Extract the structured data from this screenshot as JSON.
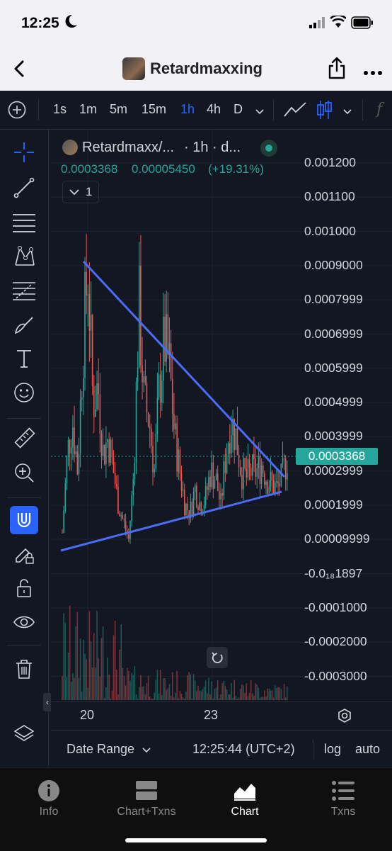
{
  "status": {
    "time": "12:25"
  },
  "nav": {
    "title": "Retardmaxxing"
  },
  "toolbar": {
    "timeframes": [
      "1s",
      "1m",
      "5m",
      "15m",
      "1h",
      "4h",
      "D"
    ],
    "active_timeframe": "1h"
  },
  "legend": {
    "symbol": "Retardmaxx/...",
    "interval": "· 1h · d...",
    "price": "0.0003368",
    "change": "0.00005450",
    "change_pct": "(+19.31%)",
    "indicator_count": "1"
  },
  "colors": {
    "up": "#26a69a",
    "down": "#ef5350",
    "trendline": "#4a6cf7",
    "accent": "#2962ff",
    "price_tag": "#26a69a"
  },
  "chart_data": {
    "type": "candlestick",
    "price_axis_labels": [
      "0.001200",
      "0.001100",
      "0.001000",
      "0.0009000",
      "0.0007999",
      "0.0006999",
      "0.0005999",
      "0.0004999",
      "0.0003999",
      "0.0002999",
      "0.0001999",
      "0.00009999",
      "-0.0₁₈1897",
      "-0.0001000",
      "-0.0002000",
      "-0.0003000"
    ],
    "current_price_label": "0.0003368",
    "time_axis_labels": [
      "20",
      "23"
    ],
    "series": [
      {
        "values": [
          0.00012,
          0.00035,
          0.00045,
          0.0003,
          0.00065,
          0.0009,
          0.0005,
          0.00055,
          0.00035,
          0.0004,
          0.0003,
          0.0002,
          0.00015,
          0.0001,
          0.0003,
          0.00079,
          0.0005,
          0.00045,
          0.0003,
          0.00055,
          0.00068,
          0.0006,
          0.0004,
          0.0003,
          0.0002,
          0.00018,
          0.00025,
          0.0002,
          0.00022,
          0.0003,
          0.00028,
          0.0002,
          0.00035,
          0.00045,
          0.0004,
          0.0003,
          0.00028,
          0.0003,
          0.0003,
          0.00032,
          0.00028,
          0.00026,
          0.00025,
          0.00028,
          0.00034
        ]
      }
    ]
  },
  "bottom": {
    "date_range": "Date Range",
    "clock": "12:25:44 (UTC+2)",
    "log": "log",
    "auto": "auto"
  },
  "tabs": [
    {
      "label": "Info"
    },
    {
      "label": "Chart+Txns"
    },
    {
      "label": "Chart"
    },
    {
      "label": "Txns"
    }
  ],
  "active_tab": "Chart"
}
